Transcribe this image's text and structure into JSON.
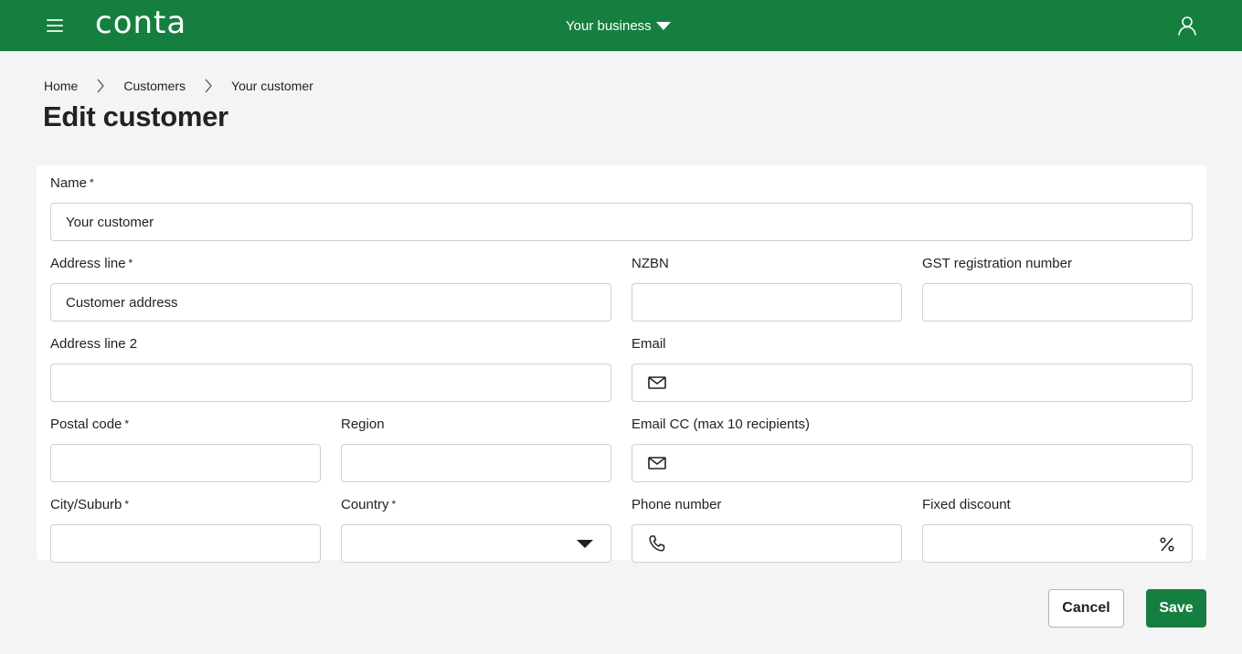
{
  "header": {
    "logo_text": "conta",
    "business_selector_label": "Your business",
    "brand_color": "#157f40"
  },
  "breadcrumb": {
    "items": [
      "Home",
      "Customers",
      "Your customer"
    ]
  },
  "page": {
    "title": "Edit customer"
  },
  "form": {
    "name": {
      "label": "Name",
      "required_mark": "*",
      "value": "Your customer"
    },
    "address_line": {
      "label": "Address line",
      "required_mark": "*",
      "value": "Customer address"
    },
    "nzbn": {
      "label": "NZBN",
      "value": ""
    },
    "gst": {
      "label": "GST registration number",
      "value": ""
    },
    "address_line_2": {
      "label": "Address line 2",
      "value": ""
    },
    "email": {
      "label": "Email",
      "value": "",
      "icon": "mail-icon"
    },
    "postal_code": {
      "label": "Postal code",
      "required_mark": "*",
      "value": ""
    },
    "region": {
      "label": "Region",
      "value": ""
    },
    "email_cc": {
      "label": "Email CC (max 10 recipients)",
      "value": "",
      "icon": "mail-icon"
    },
    "city": {
      "label": "City/Suburb",
      "required_mark": "*",
      "value": ""
    },
    "country": {
      "label": "Country",
      "required_mark": "*",
      "selected": ""
    },
    "phone": {
      "label": "Phone number",
      "value": "",
      "icon": "phone-icon"
    },
    "fixed_discount": {
      "label": "Fixed discount",
      "value": "",
      "suffix": "%"
    }
  },
  "actions": {
    "cancel_label": "Cancel",
    "save_label": "Save"
  }
}
